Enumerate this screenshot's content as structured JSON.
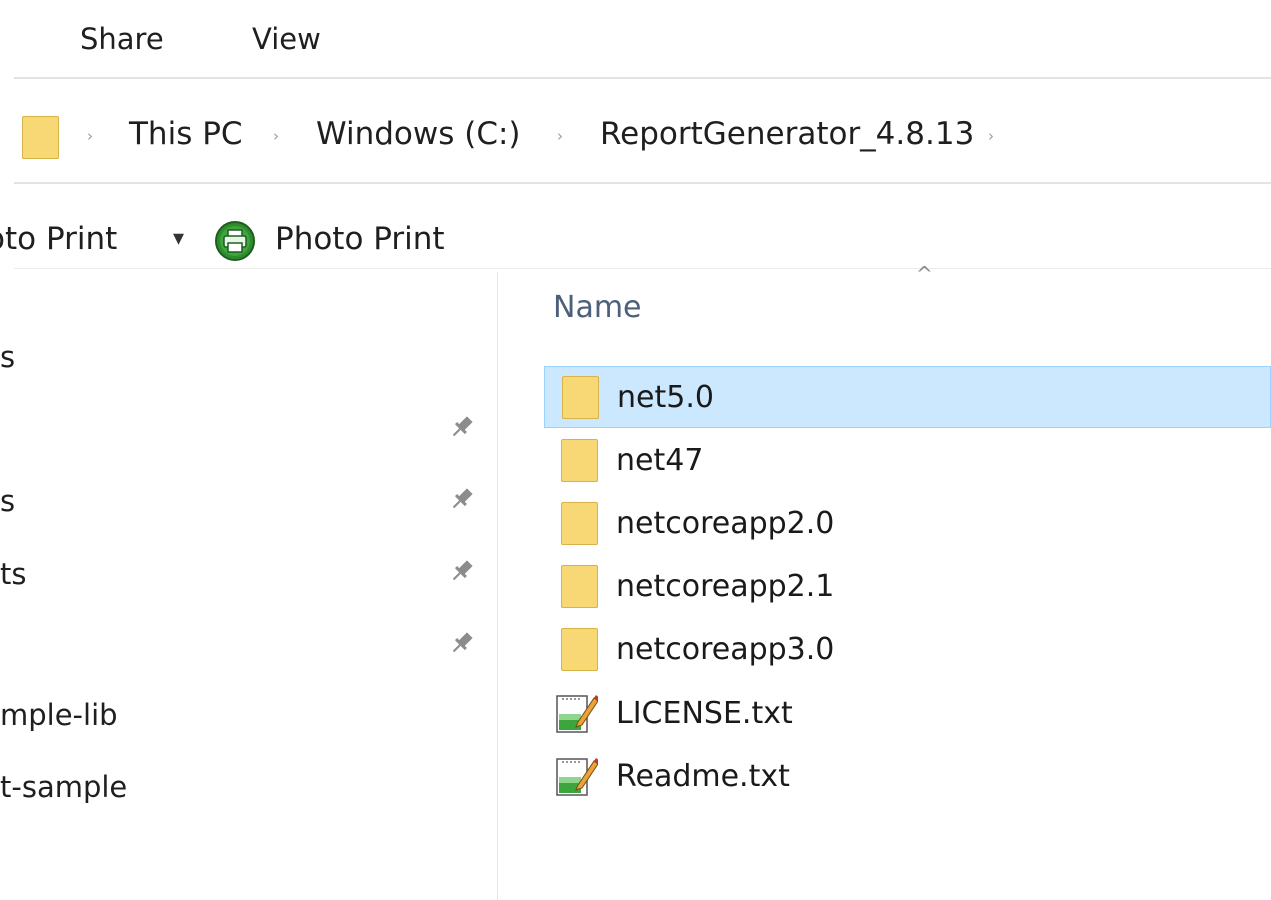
{
  "ribbon": {
    "tabs": [
      {
        "label": "Share"
      },
      {
        "label": "View"
      }
    ]
  },
  "address_bar": {
    "crumbs": [
      "This PC",
      "Windows (C:)",
      "ReportGenerator_4.8.13"
    ],
    "separator": "›"
  },
  "command_bar": {
    "dropdown_label": "oto Print",
    "dropdown_arrow": "▾",
    "action_label": "Photo Print"
  },
  "nav_pane": {
    "items": [
      {
        "label": "s",
        "pinned": false
      },
      {
        "label": "",
        "pinned": true
      },
      {
        "label": "s",
        "pinned": true
      },
      {
        "label": "ts",
        "pinned": true
      },
      {
        "label": "",
        "pinned": true
      },
      {
        "label": "mple-lib",
        "pinned": false
      },
      {
        "label": "t-sample",
        "pinned": false
      }
    ]
  },
  "file_list": {
    "column_header": "Name",
    "sort_indicator": "^",
    "items": [
      {
        "name": "net5.0",
        "type": "folder",
        "selected": true
      },
      {
        "name": "net47",
        "type": "folder",
        "selected": false
      },
      {
        "name": "netcoreapp2.0",
        "type": "folder",
        "selected": false
      },
      {
        "name": "netcoreapp2.1",
        "type": "folder",
        "selected": false
      },
      {
        "name": "netcoreapp3.0",
        "type": "folder",
        "selected": false
      },
      {
        "name": "LICENSE.txt",
        "type": "text-file",
        "selected": false
      },
      {
        "name": "Readme.txt",
        "type": "text-file",
        "selected": false
      }
    ]
  },
  "colors": {
    "selection_bg": "#cce8ff",
    "selection_border": "#99d1ff",
    "folder_yellow": "#f8d775",
    "print_icon_green": "#2e8b2e"
  }
}
